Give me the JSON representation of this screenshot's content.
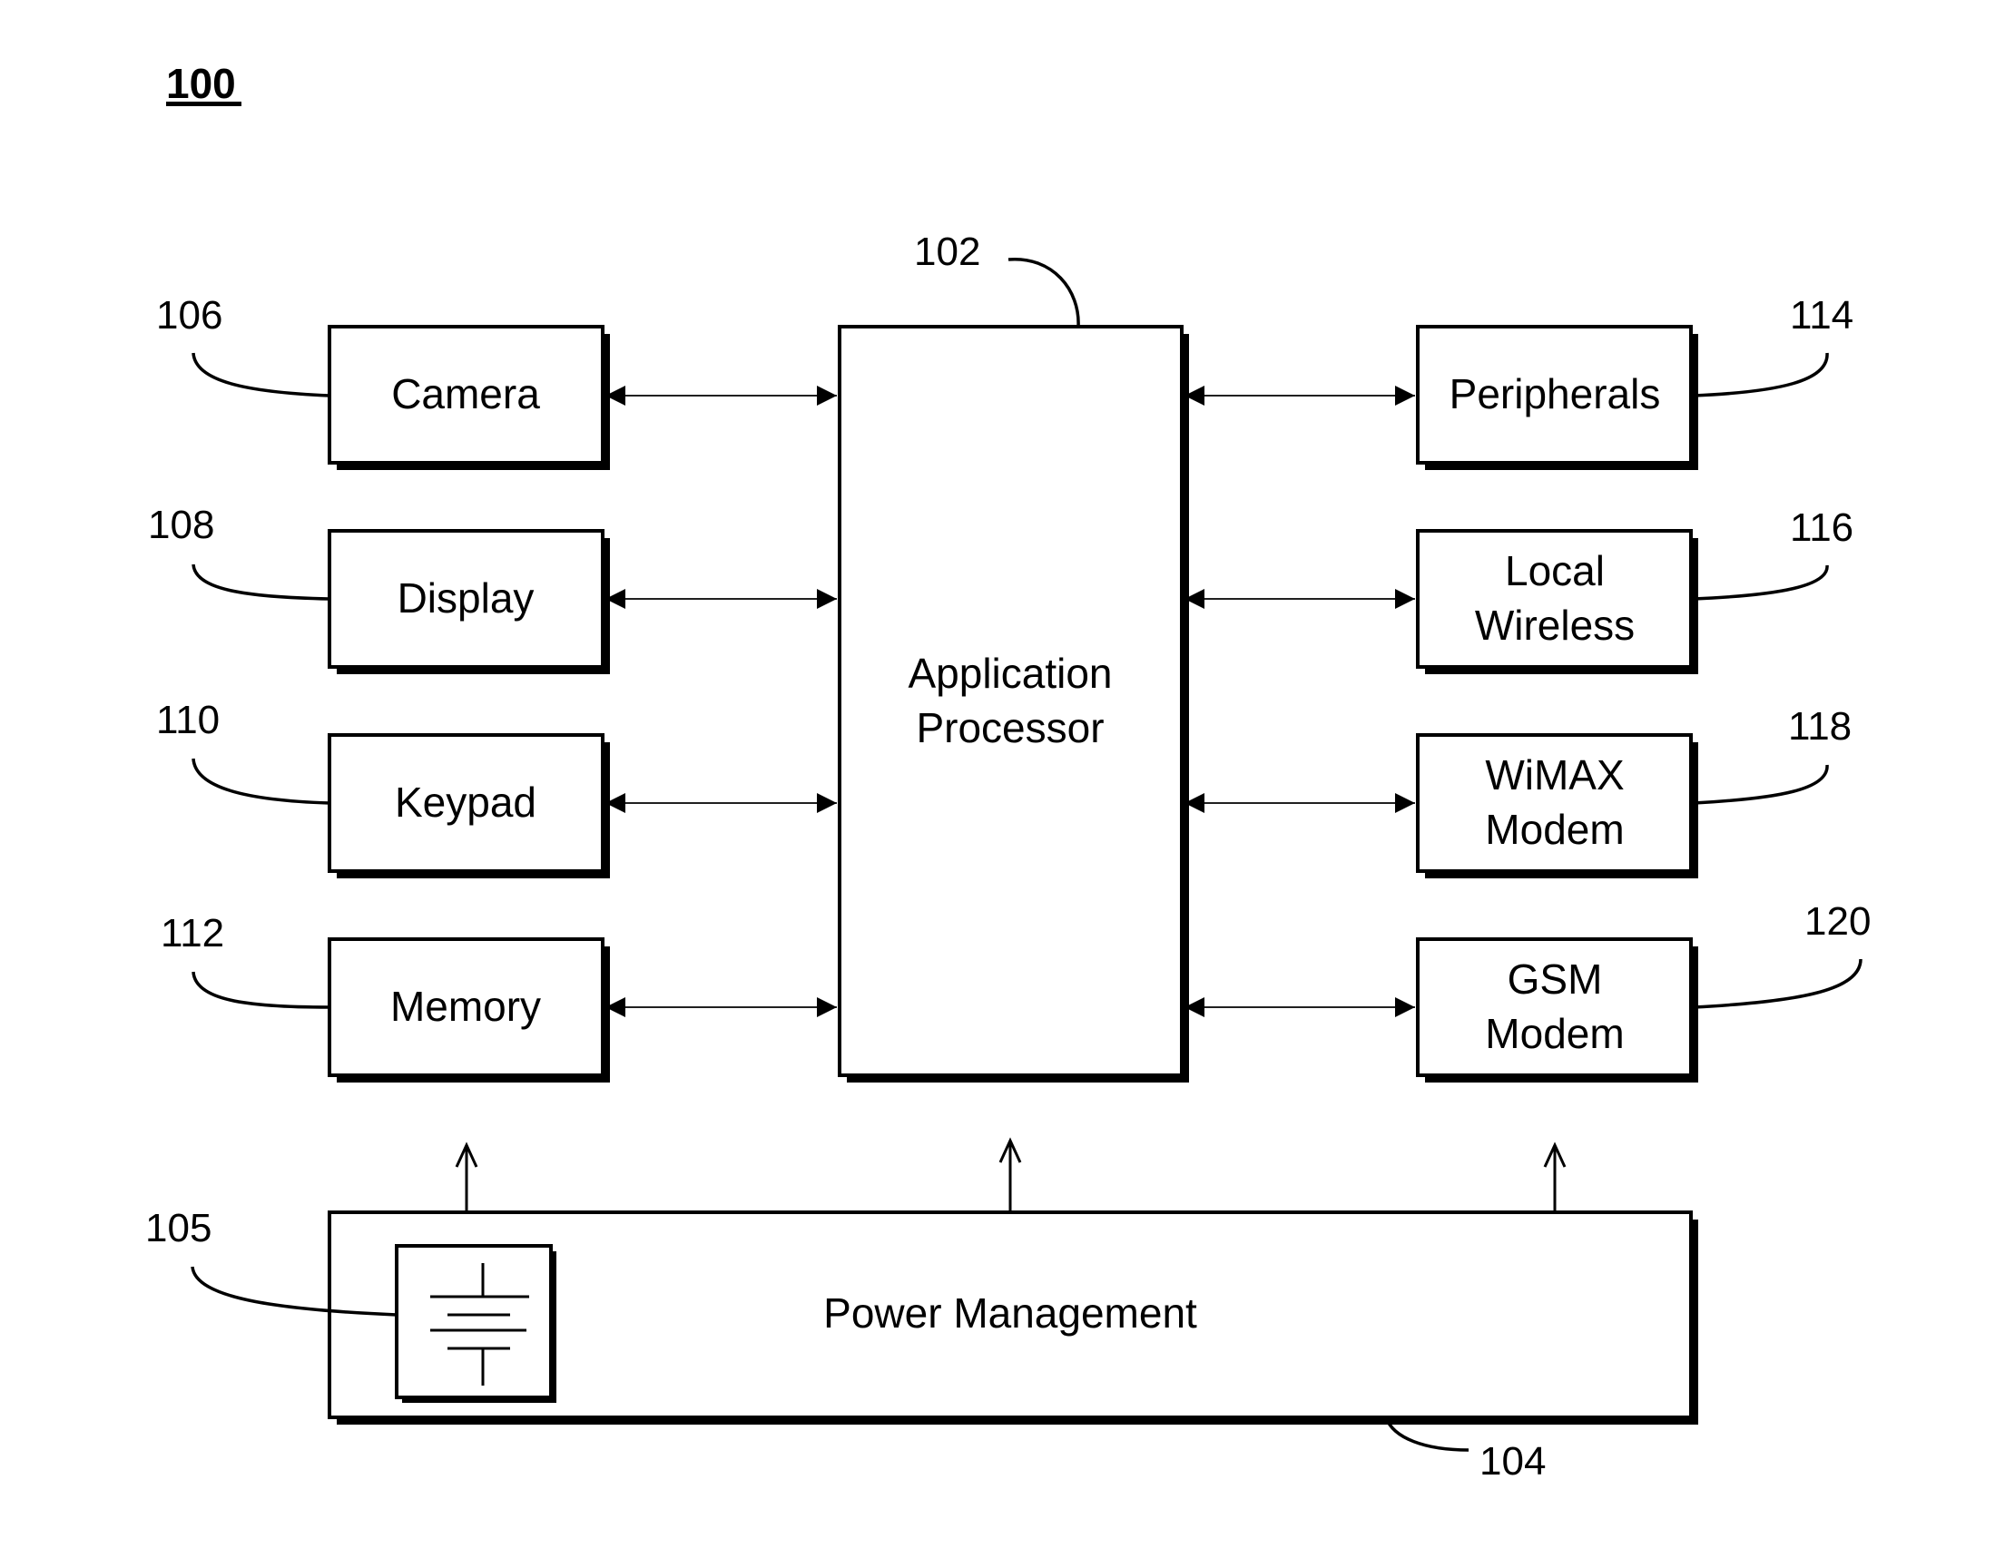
{
  "figure": {
    "number": "100"
  },
  "application_processor": {
    "ref": "102",
    "label_lines": [
      "Application",
      "Processor"
    ]
  },
  "left_components": [
    {
      "ref": "106",
      "label_lines": [
        "Camera"
      ]
    },
    {
      "ref": "108",
      "label_lines": [
        "Display"
      ]
    },
    {
      "ref": "110",
      "label_lines": [
        "Keypad"
      ]
    },
    {
      "ref": "112",
      "label_lines": [
        "Memory"
      ]
    }
  ],
  "right_components": [
    {
      "ref": "114",
      "label_lines": [
        "Peripherals"
      ]
    },
    {
      "ref": "116",
      "label_lines": [
        "Local",
        "Wireless"
      ]
    },
    {
      "ref": "118",
      "label_lines": [
        "WiMAX",
        "Modem"
      ]
    },
    {
      "ref": "120",
      "label_lines": [
        "GSM",
        "Modem"
      ]
    }
  ],
  "power_management": {
    "ref": "104",
    "label": "Power Management",
    "battery": {
      "ref": "105",
      "icon": "battery-icon"
    }
  },
  "connections": {
    "left_to_processor": "bidirectional",
    "right_to_processor": "bidirectional",
    "power_supply_arrows": 3
  }
}
